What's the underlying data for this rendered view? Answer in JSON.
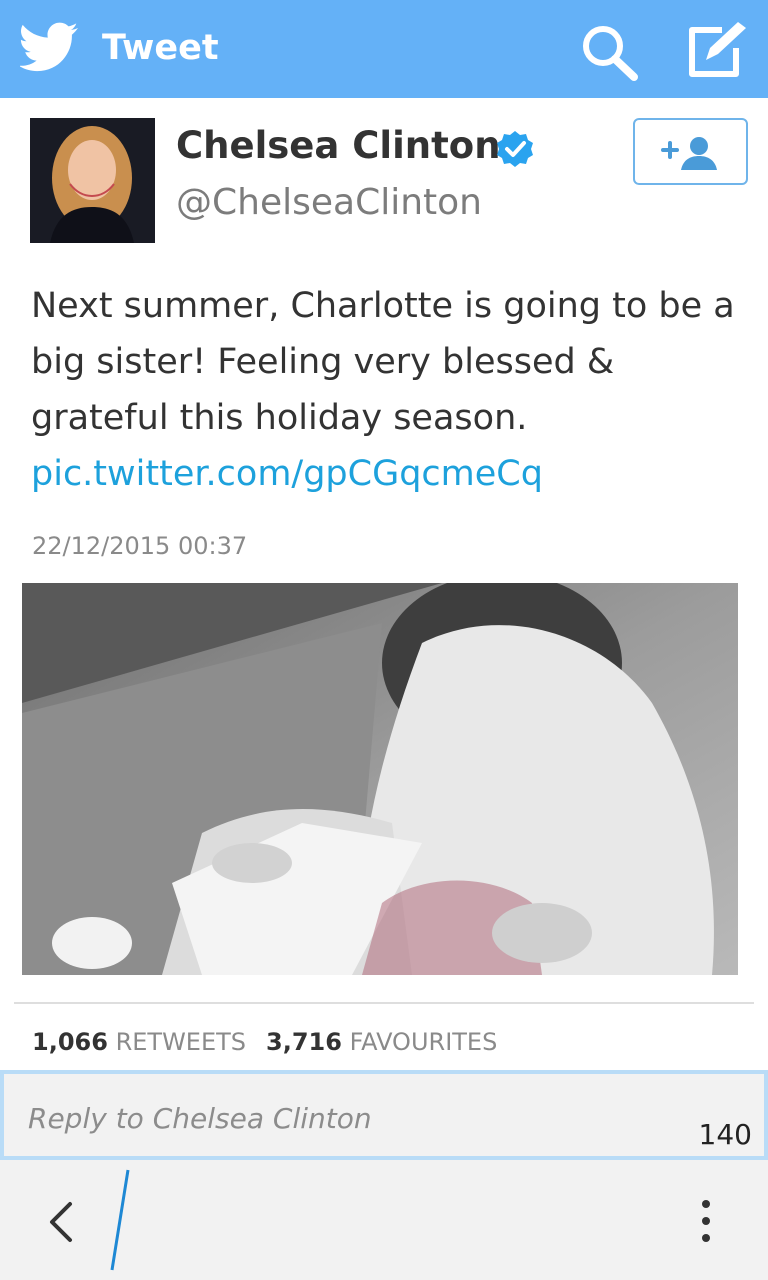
{
  "app": {
    "title": "Tweet"
  },
  "colors": {
    "header": "#64b1f7",
    "link": "#1da1dc",
    "verified": "#2aa3ef",
    "reply_border": "#b9dcf7"
  },
  "icons": {
    "header_left": "twitter-bird-icon",
    "search": "search-icon",
    "compose": "compose-icon",
    "follow": "add-user-icon",
    "verified": "verified-badge-icon",
    "back": "chevron-left-icon",
    "menu": "overflow-menu-icon"
  },
  "user": {
    "name": "Chelsea Clinton",
    "handle": "@ChelseaClinton"
  },
  "tweet": {
    "text": "Next summer, Charlotte is going to be a big sister! Feeling very blessed & grateful this holiday season.",
    "link": "pic.twitter.com/gpCGqcmeCq",
    "timestamp": "22/12/2015 00:37"
  },
  "stats": {
    "retweets_count": "1,066",
    "retweets_label": "RETWEETS",
    "favourites_count": "3,716",
    "favourites_label": "FAVOURITES"
  },
  "reply": {
    "placeholder": "Reply to Chelsea Clinton",
    "char_count": "140"
  }
}
